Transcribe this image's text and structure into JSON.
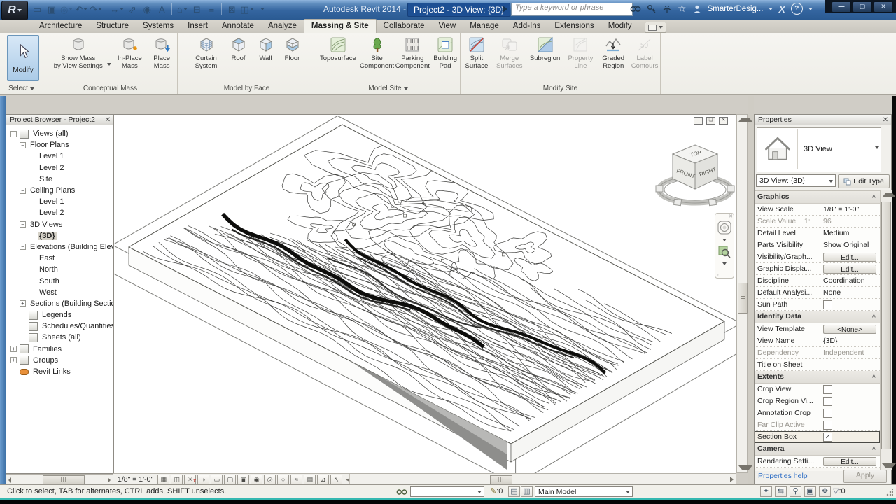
{
  "title_bar": {
    "app_title": "Autodesk Revit 2014 -",
    "doc_title": "Project2 - 3D View: {3D}",
    "search_placeholder": "Type a keyword or phrase",
    "user_name": "SmarterDesig...",
    "qat": [
      {
        "name": "open-file-icon",
        "glyph": "▭"
      },
      {
        "name": "save-icon",
        "glyph": "▣"
      },
      {
        "name": "transfer-icon",
        "glyph": "◎",
        "dropdown": true,
        "disabled": true
      },
      {
        "name": "undo-icon",
        "glyph": "↶",
        "dropdown": true
      },
      {
        "name": "redo-icon",
        "glyph": "↷",
        "dropdown": true
      },
      {
        "name": "measure-icon",
        "glyph": "↔",
        "dropdown": true,
        "sep": true
      },
      {
        "name": "aligned-dimension-icon",
        "glyph": "⇗"
      },
      {
        "name": "tag-icon",
        "glyph": "◉"
      },
      {
        "name": "text-icon",
        "glyph": "A"
      },
      {
        "name": "default-3d-view-icon",
        "glyph": "⌂",
        "dropdown": true,
        "sep": true
      },
      {
        "name": "section-icon",
        "glyph": "⊟"
      },
      {
        "name": "thin-lines-icon",
        "glyph": "≡"
      },
      {
        "name": "close-hidden-windows-icon",
        "glyph": "⊠",
        "sep": true
      },
      {
        "name": "switch-windows-icon",
        "glyph": "◫",
        "dropdown": true
      },
      {
        "name": "customize-qat-icon",
        "glyph": "",
        "dropdown": true
      }
    ]
  },
  "tabs": [
    {
      "label": "Architecture"
    },
    {
      "label": "Structure"
    },
    {
      "label": "Systems"
    },
    {
      "label": "Insert"
    },
    {
      "label": "Annotate"
    },
    {
      "label": "Analyze"
    },
    {
      "label": "Massing & Site",
      "active": true
    },
    {
      "label": "Collaborate"
    },
    {
      "label": "View"
    },
    {
      "label": "Manage"
    },
    {
      "label": "Add-Ins"
    },
    {
      "label": "Extensions"
    },
    {
      "label": "Modify"
    }
  ],
  "ribbon": {
    "select_panel": "Select",
    "modify_label": "Modify",
    "panels": [
      {
        "name": "Conceptual Mass",
        "buttons": [
          {
            "label": "Show Mass\nby View Settings",
            "dropdown": true
          },
          {
            "label": "In-Place\nMass"
          },
          {
            "label": "Place\nMass"
          }
        ]
      },
      {
        "name": "Model by Face",
        "buttons": [
          {
            "label": "Curtain\nSystem"
          },
          {
            "label": "Roof"
          },
          {
            "label": "Wall"
          },
          {
            "label": "Floor"
          }
        ]
      },
      {
        "name": "Model Site",
        "buttons": [
          {
            "label": "Toposurface"
          },
          {
            "label": "Site\nComponent"
          },
          {
            "label": "Parking\nComponent"
          },
          {
            "label": "Building\nPad"
          }
        ]
      },
      {
        "name": "Modify Site",
        "buttons": [
          {
            "label": "Split\nSurface"
          },
          {
            "label": "Merge\nSurfaces",
            "disabled": true
          },
          {
            "label": "Subregion"
          },
          {
            "label": "Property\nLine",
            "disabled": true
          },
          {
            "label": "Graded\nRegion"
          },
          {
            "label": "Label\nContours",
            "disabled": true
          }
        ]
      }
    ]
  },
  "project_browser": {
    "title": "Project Browser - Project2",
    "tree": [
      {
        "label": "Views (all)",
        "level": 0,
        "expand": "minus",
        "icon": "views"
      },
      {
        "label": "Floor Plans",
        "level": 1,
        "expand": "minus"
      },
      {
        "label": "Level 1",
        "level": 2
      },
      {
        "label": "Level 2",
        "level": 2
      },
      {
        "label": "Site",
        "level": 2
      },
      {
        "label": "Ceiling Plans",
        "level": 1,
        "expand": "minus"
      },
      {
        "label": "Level 1",
        "level": 2
      },
      {
        "label": "Level 2",
        "level": 2
      },
      {
        "label": "3D Views",
        "level": 1,
        "expand": "minus"
      },
      {
        "label": "{3D}",
        "level": 2,
        "selected": true
      },
      {
        "label": "Elevations (Building Elev",
        "level": 1,
        "expand": "minus"
      },
      {
        "label": "East",
        "level": 2
      },
      {
        "label": "North",
        "level": 2
      },
      {
        "label": "South",
        "level": 2
      },
      {
        "label": "West",
        "level": 2
      },
      {
        "label": "Sections (Building Sectio",
        "level": 1,
        "expand": "plus"
      },
      {
        "label": "Legends",
        "level": 1,
        "icon": "legends"
      },
      {
        "label": "Schedules/Quantities",
        "level": 1,
        "icon": "schedules"
      },
      {
        "label": "Sheets (all)",
        "level": 1,
        "icon": "sheets"
      },
      {
        "label": "Families",
        "level": 0,
        "expand": "plus",
        "icon": "families"
      },
      {
        "label": "Groups",
        "level": 0,
        "expand": "plus",
        "icon": "groups"
      },
      {
        "label": "Revit Links",
        "level": 0,
        "icon": "links"
      }
    ]
  },
  "viewport": {
    "viewcube": {
      "top": "TOP",
      "front": "FRONT",
      "right": "RIGHT"
    },
    "scale_label": "1/8\" = 1'-0\""
  },
  "view_control_icons": [
    {
      "name": "detail-level-icon",
      "glyph": "▦"
    },
    {
      "name": "visual-style-icon",
      "glyph": "◫"
    },
    {
      "name": "sun-path-icon",
      "glyph": "☀",
      "off": true
    },
    {
      "name": "shadows-icon",
      "glyph": "◑"
    },
    {
      "name": "rendering-dialog-icon",
      "glyph": "▭"
    },
    {
      "name": "crop-view-icon",
      "glyph": "▢"
    },
    {
      "name": "show-crop-region-icon",
      "glyph": "▣"
    },
    {
      "name": "lock-3d-view-icon",
      "glyph": "◉"
    },
    {
      "name": "temporary-hide-isolate-icon",
      "glyph": "◎"
    },
    {
      "name": "reveal-hidden-elements-icon",
      "glyph": "○"
    },
    {
      "name": "worksharing-display-icon",
      "glyph": "≈"
    },
    {
      "name": "temporary-view-properties-icon",
      "glyph": "▤"
    },
    {
      "name": "analytical-model-icon",
      "glyph": "⊿"
    },
    {
      "name": "displacement-sets-icon",
      "glyph": "↖"
    }
  ],
  "properties": {
    "title": "Properties",
    "type_name": "3D View",
    "instance_selector": "3D View: {3D}",
    "edit_type_label": "Edit Type",
    "rows": [
      {
        "type": "group",
        "label": "Graphics"
      },
      {
        "label": "View Scale",
        "value": "1/8\" = 1'-0\""
      },
      {
        "label": "Scale Value    1:",
        "value": "96",
        "gray": true
      },
      {
        "label": "Detail Level",
        "value": "Medium"
      },
      {
        "label": "Parts Visibility",
        "value": "Show Original"
      },
      {
        "label": "Visibility/Graph...",
        "value": "Edit...",
        "type": "button"
      },
      {
        "label": "Graphic Displa...",
        "value": "Edit...",
        "type": "button"
      },
      {
        "label": "Discipline",
        "value": "Coordination"
      },
      {
        "label": "Default Analysi...",
        "value": "None"
      },
      {
        "label": "Sun Path",
        "type": "checkbox",
        "checked": false
      },
      {
        "type": "group",
        "label": "Identity Data"
      },
      {
        "label": "View Template",
        "value": "<None>",
        "type": "button"
      },
      {
        "label": "View Name",
        "value": "{3D}"
      },
      {
        "label": "Dependency",
        "value": "Independent",
        "gray": true
      },
      {
        "label": "Title on Sheet",
        "value": ""
      },
      {
        "type": "group",
        "label": "Extents"
      },
      {
        "label": "Crop View",
        "type": "checkbox",
        "checked": false
      },
      {
        "label": "Crop Region Vi...",
        "type": "checkbox",
        "checked": false
      },
      {
        "label": "Annotation Crop",
        "type": "checkbox",
        "checked": false
      },
      {
        "label": "Far Clip Active",
        "type": "checkbox",
        "checked": false,
        "gray": true
      },
      {
        "label": "Section Box",
        "type": "checkbox",
        "checked": true,
        "selected": true
      },
      {
        "type": "group",
        "label": "Camera"
      },
      {
        "label": "Rendering Setti...",
        "value": "Edit...",
        "type": "button"
      }
    ],
    "help_link": "Properties help",
    "apply_label": "Apply"
  },
  "status_bar": {
    "message": "Click to select, TAB for alternates, CTRL adds, SHIFT unselects.",
    "editing_requests_count": ":0",
    "main_model_label": "Main Model",
    "filter_count": ":0",
    "right_icons": [
      {
        "name": "editable-only-icon",
        "glyph": "✦"
      },
      {
        "name": "editing-requests-icon",
        "glyph": "⇆"
      },
      {
        "name": "worksharing-status-icon",
        "glyph": "⚲"
      },
      {
        "name": "exclude-options-icon",
        "glyph": "▣"
      },
      {
        "name": "press-drag-icon",
        "glyph": "✥"
      }
    ]
  }
}
